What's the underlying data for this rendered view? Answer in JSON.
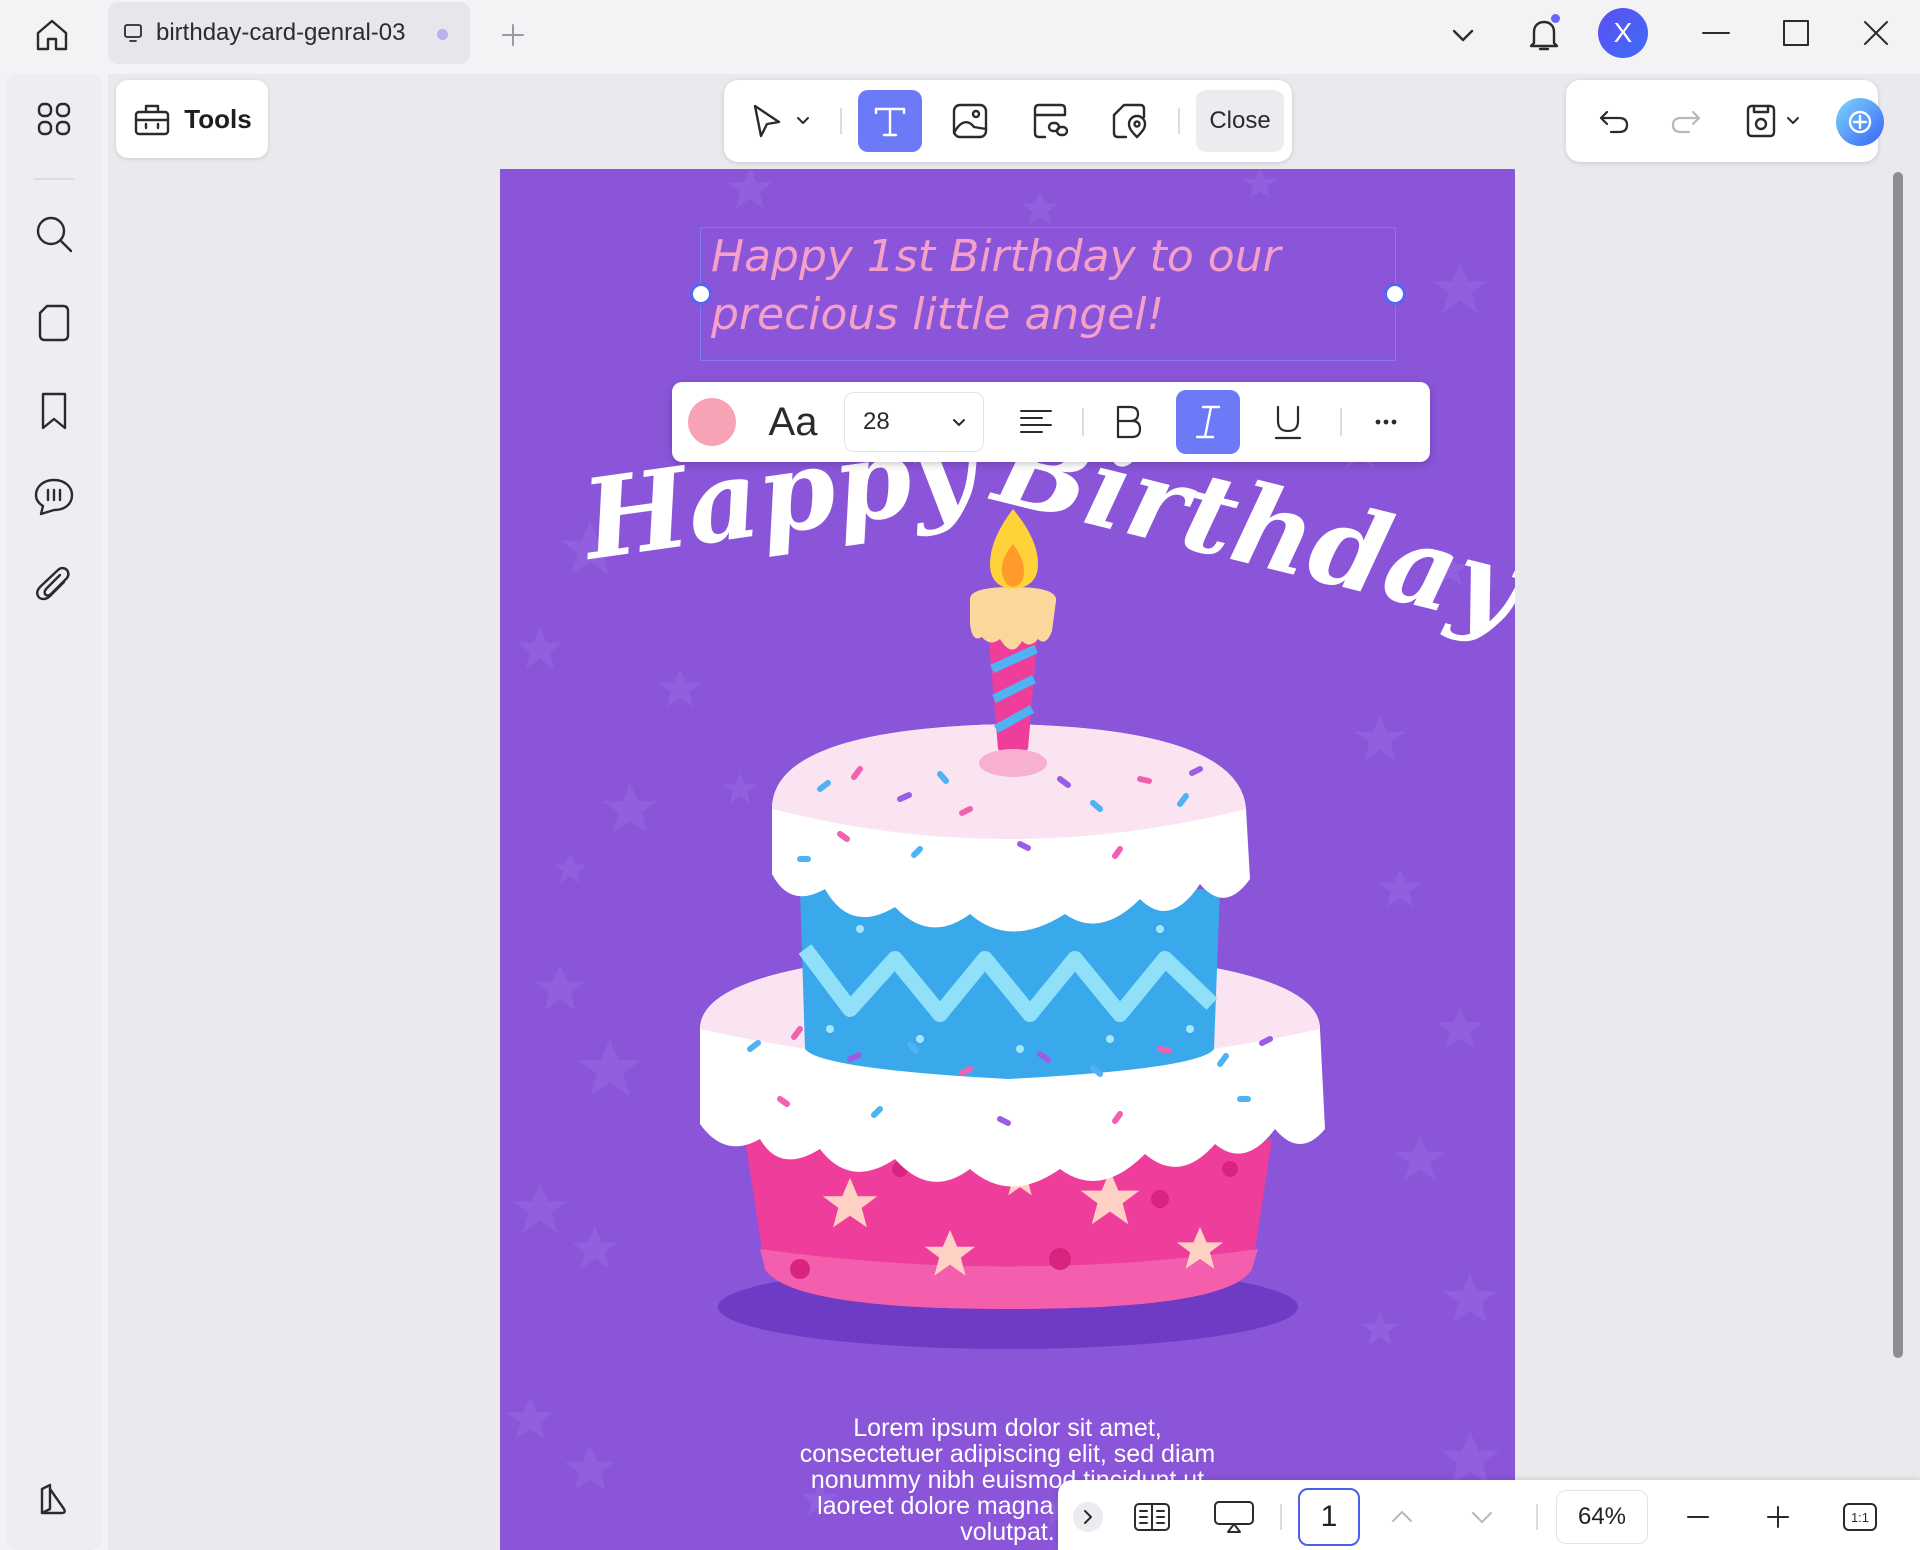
{
  "titlebar": {
    "tab_title": "birthday-card-genral-03",
    "avatar_initial": "X"
  },
  "sidebar": {
    "items": [
      {
        "name": "thumbnails",
        "icon": "grid-icon"
      },
      {
        "name": "search",
        "icon": "search-icon"
      },
      {
        "name": "pages",
        "icon": "page-icon"
      },
      {
        "name": "bookmarks",
        "icon": "bookmark-icon"
      },
      {
        "name": "comments",
        "icon": "comment-icon"
      },
      {
        "name": "attachments",
        "icon": "paperclip-icon"
      },
      {
        "name": "layers",
        "icon": "layers-icon"
      }
    ]
  },
  "toolbar": {
    "tools_label": "Tools",
    "close_label": "Close",
    "active_tool": "text"
  },
  "card": {
    "text_box": {
      "line1": "Happy 1st Birthday to our",
      "line2": "precious little angel!"
    },
    "headline": "Happy Birthday",
    "body_lines": [
      "Lorem ipsum dolor sit amet,",
      "consectetuer adipiscing elit, sed diam",
      "nonummy nibh euismod tincidunt ut",
      "laoreet dolore magna aliquam erat",
      "volutpat."
    ],
    "background_color": "#8a55d9"
  },
  "format_toolbar": {
    "color": "#f7a3b5",
    "font_label": "Aa",
    "font_size": "28",
    "italic_active": true
  },
  "bottom_bar": {
    "page_number": "1",
    "zoom": "64%",
    "actual_size_label": "1:1"
  },
  "colors": {
    "accent": "#6c7af7",
    "selection": "#5566f2"
  }
}
